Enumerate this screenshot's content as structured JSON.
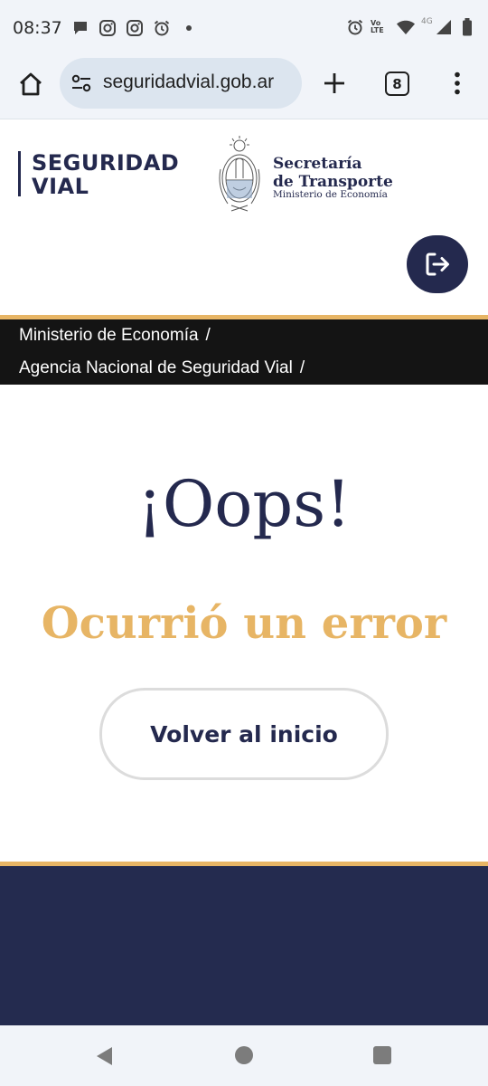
{
  "status_bar": {
    "time": "08:37",
    "left_icons": [
      "chat-bubble-icon",
      "instagram-icon",
      "instagram-icon",
      "alarm-icon",
      "dot-icon"
    ],
    "right_icons": [
      "alarm-icon",
      "volte-icon",
      "wifi-icon",
      "4g-signal-icon",
      "battery-icon"
    ],
    "volte_label": "Vo LTE",
    "network_label": "4G"
  },
  "browser": {
    "url": "seguridadvial.gob.ar",
    "tab_count": "8",
    "home_icon": "home-icon",
    "site_settings_icon": "tune-icon",
    "new_tab_icon": "plus-icon",
    "menu_icon": "more-vertical-icon"
  },
  "header": {
    "logo_line1": "SEGURIDAD",
    "logo_line2": "VIAL",
    "secretaria_line1": "Secretaría",
    "secretaria_line2": "de Transporte",
    "ministerio": "Ministerio de Economía",
    "logout_icon": "logout-icon"
  },
  "breadcrumb": {
    "items": [
      {
        "label": "Ministerio de Economía",
        "separator": "/"
      },
      {
        "label": "Agencia Nacional de Seguridad Vial",
        "separator": "/"
      }
    ]
  },
  "main": {
    "heading": "¡Oops!",
    "error_message": "Ocurrió un error",
    "back_button_label": "Volver al inicio"
  },
  "colors": {
    "navy": "#24294e",
    "gold": "#e7b565",
    "breadcrumb_bg": "#141414",
    "footer_bg": "#242b4f"
  }
}
